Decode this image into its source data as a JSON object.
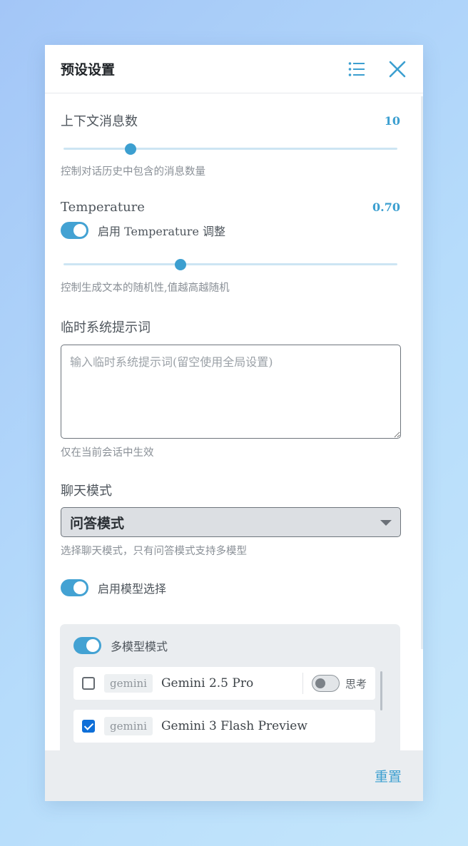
{
  "header": {
    "title": "预设设置"
  },
  "context": {
    "label": "上下文消息数",
    "value": "10",
    "slider_fraction": 0.2,
    "help": "控制对话历史中包含的消息数量"
  },
  "temperature": {
    "label": "Temperature",
    "value": "0.70",
    "toggle_label": "启用 Temperature 调整",
    "toggle_on": true,
    "slider_fraction": 0.35,
    "help": "控制生成文本的随机性,值越高越随机"
  },
  "system_prompt": {
    "label": "临时系统提示词",
    "placeholder": "输入临时系统提示词(留空使用全局设置)",
    "help": "仅在当前会话中生效"
  },
  "chat_mode": {
    "label": "聊天模式",
    "selected": "问答模式",
    "help": "选择聊天模式，只有问答模式支持多模型"
  },
  "model_select": {
    "toggle_label": "启用模型选择",
    "toggle_on": true
  },
  "multi_model": {
    "toggle_label": "多模型模式",
    "toggle_on": true,
    "models": [
      {
        "provider": "gemini",
        "name": "Gemini 2.5 Pro",
        "checked": false,
        "think_label": "思考",
        "think_on": false
      },
      {
        "provider": "gemini",
        "name": "Gemini 3 Flash Preview",
        "checked": true
      }
    ]
  },
  "footer": {
    "reset_label": "重置"
  },
  "colors": {
    "accent": "#3c9fd0",
    "checkbox_checked": "#0f6fd8"
  },
  "icons": {
    "menu": "list-icon",
    "close": "close-icon"
  }
}
